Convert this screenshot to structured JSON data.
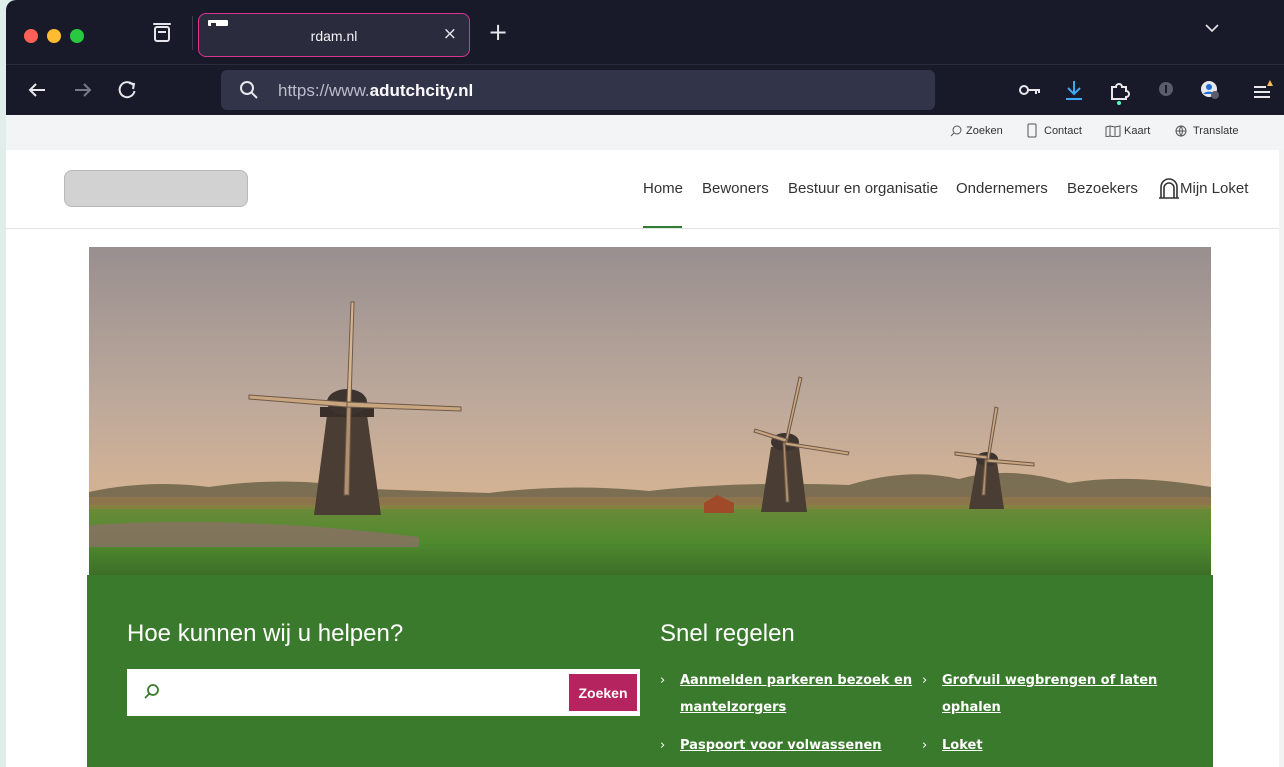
{
  "browser": {
    "tab_title": "rdam.nl",
    "tab_close": "×",
    "new_tab": "+",
    "url_scheme": "https://www.",
    "url_host": "adutchcity.nl",
    "icons": [
      "tab-list-icon",
      "back-icon",
      "forward-icon",
      "reload-icon",
      "search-icon",
      "key-icon",
      "download-icon",
      "extensions-icon",
      "privacy-icon",
      "account-icon",
      "menu-icon",
      "chevron-down-icon"
    ]
  },
  "utility": {
    "search": "Zoeken",
    "contact": "Contact",
    "map": "Kaart",
    "translate": "Translate"
  },
  "menu": {
    "items": [
      "Home",
      "Bewoners",
      "Bestuur en organisatie",
      "Ondernemers",
      "Bezoekers"
    ],
    "mijn_loket": "Mijn Loket",
    "active": "Home"
  },
  "help": {
    "heading": "Hoe kunnen wij u helpen?",
    "search_placeholder": "",
    "search_button": "Zoeken"
  },
  "quick": {
    "heading": "Snel regelen",
    "links": [
      {
        "line1": "Aanmelden parkeren bezoek en",
        "line2": "mantelzorgers"
      },
      {
        "line1": "Grofvuil wegbrengen of laten",
        "line2": "ophalen"
      },
      {
        "line1": "Paspoort voor volwassenen"
      },
      {
        "line1": "Loket"
      }
    ]
  },
  "colors": {
    "chrome": "#181a29",
    "tab_accent": "#d7358f",
    "green_panel": "#3a7a2c",
    "search_button": "#b5245e"
  }
}
